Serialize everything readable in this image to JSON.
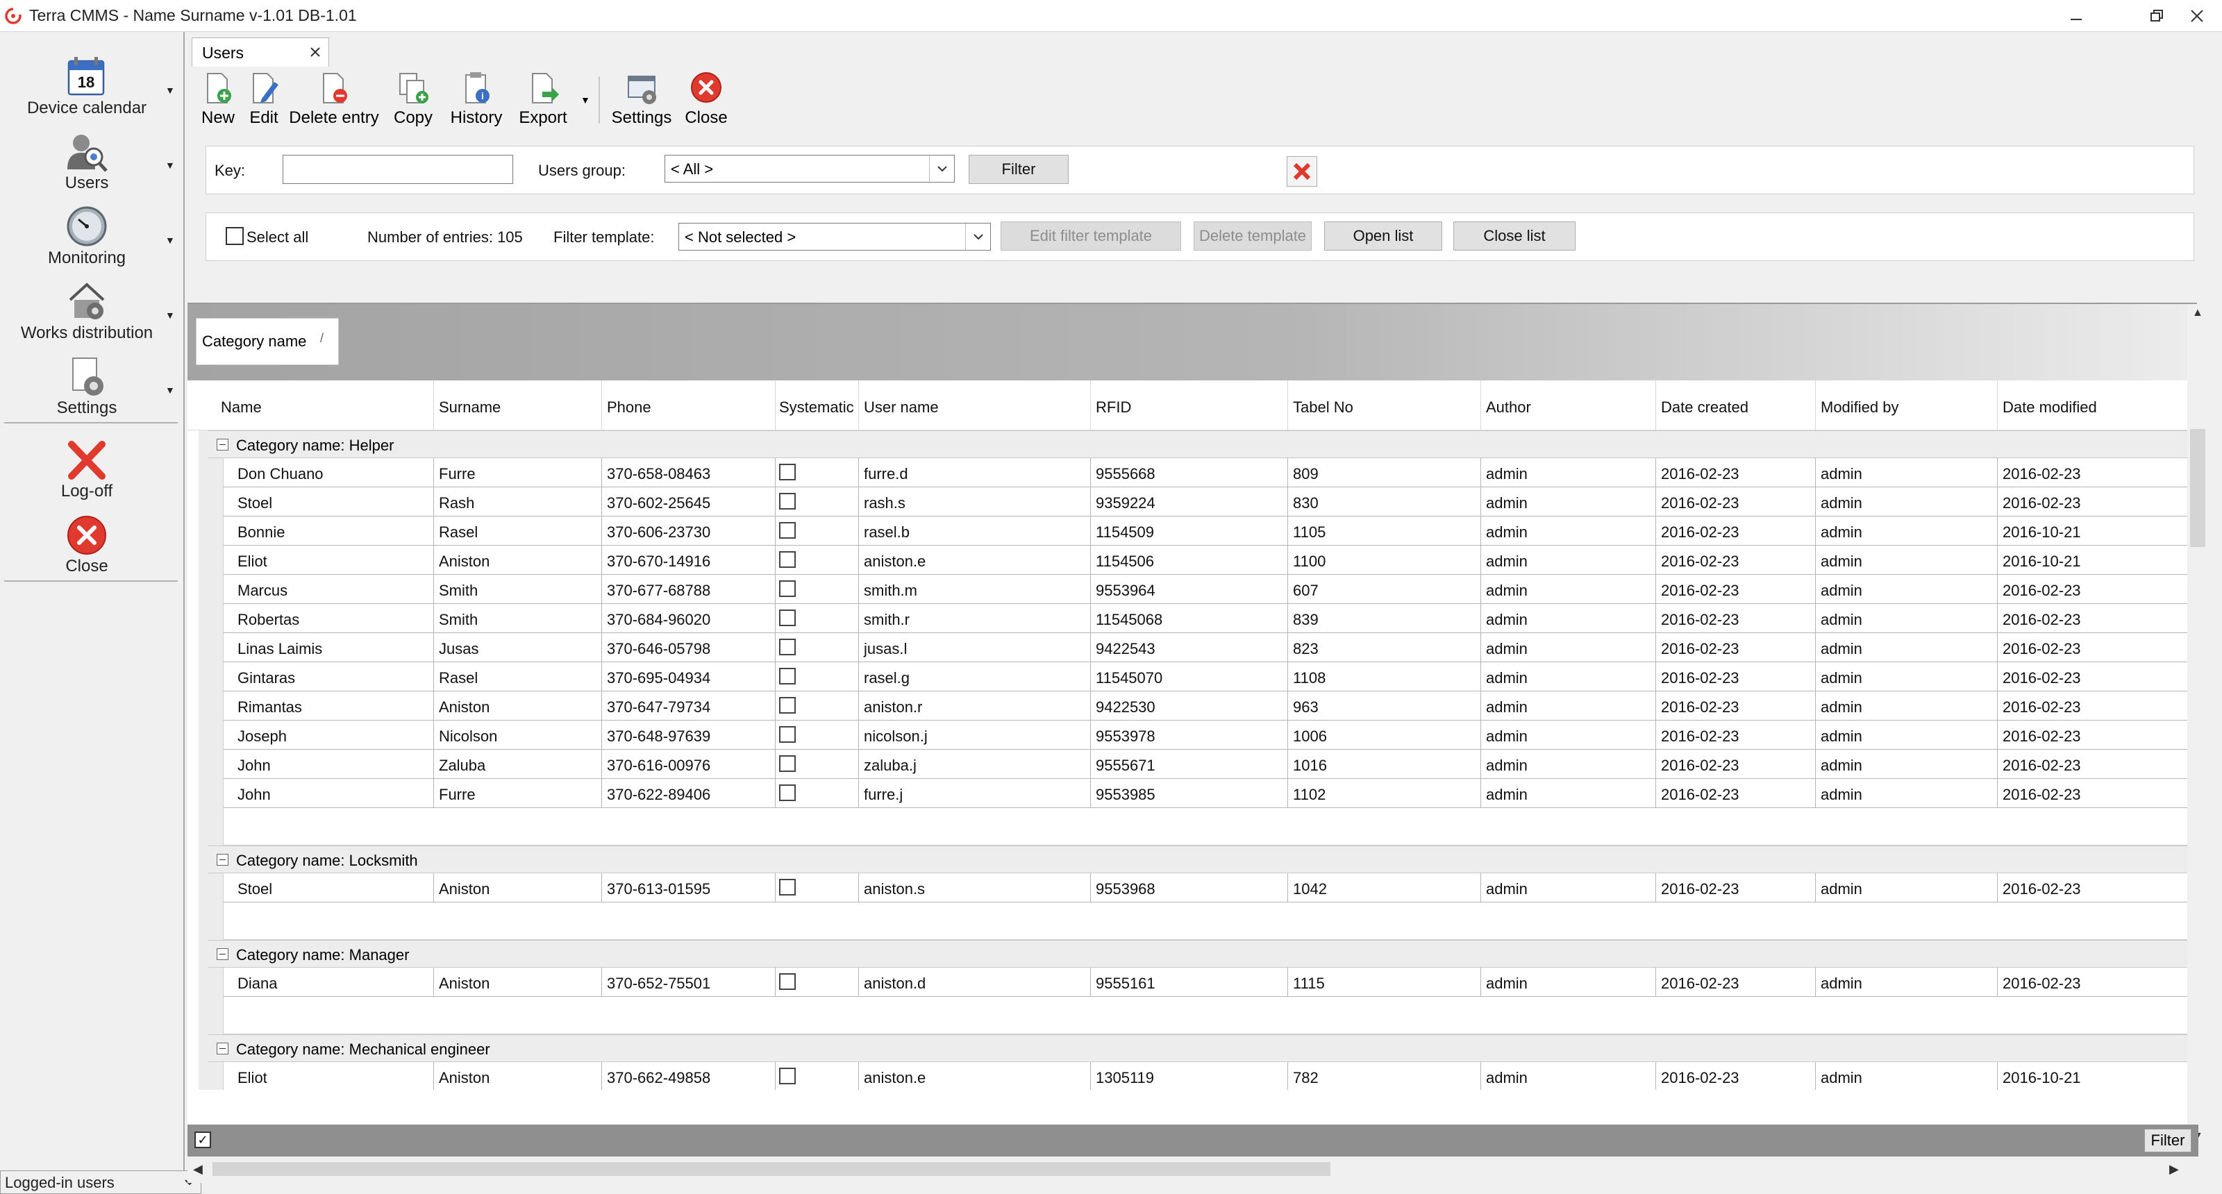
{
  "window": {
    "title": "Terra CMMS - Name Surname  v-1.01 DB-1.01"
  },
  "nav": {
    "items": [
      {
        "label": "Device calendar",
        "icon": "calendar-icon"
      },
      {
        "label": "Users",
        "icon": "users-icon"
      },
      {
        "label": "Monitoring",
        "icon": "monitoring-icon"
      },
      {
        "label": "Works distribution",
        "icon": "works-distribution-icon"
      },
      {
        "label": "Settings",
        "icon": "settings-icon"
      },
      {
        "label": "Log-off",
        "icon": "log-off-icon"
      },
      {
        "label": "Close",
        "icon": "close-icon"
      }
    ],
    "calendar_day": "18",
    "footer_label": "Logged-in users"
  },
  "tab": {
    "label": "Users"
  },
  "toolbar": {
    "new": "New",
    "edit": "Edit",
    "delete": "Delete entry",
    "copy": "Copy",
    "history": "History",
    "export": "Export",
    "settings": "Settings",
    "close": "Close"
  },
  "filter": {
    "key_label": "Key:",
    "key_value": "",
    "group_label": "Users group:",
    "group_value": "< All >",
    "filter_button": "Filter",
    "select_all": "Select all",
    "entries": "Number of entries: 105",
    "template_label": "Filter template:",
    "template_value": "< Not selected >",
    "edit_template": "Edit filter template",
    "delete_template": "Delete template",
    "open_list": "Open list",
    "close_list": "Close list"
  },
  "grid": {
    "group_by": "Category name",
    "sort_mark": "/",
    "columns": [
      "Name",
      "Surname",
      "Phone",
      "Systematic",
      "User name",
      "RFID",
      "Tabel No",
      "Author",
      "Date created",
      "Modified by",
      "Date modified"
    ],
    "groups": [
      {
        "title": "Category name: Helper",
        "rows": [
          [
            "Don Chuano",
            "Furre",
            "370-658-08463",
            "",
            "furre.d",
            "9555668",
            "809",
            "admin",
            "2016-02-23",
            "admin",
            "2016-02-23"
          ],
          [
            "Stoel",
            "Rash",
            "370-602-25645",
            "",
            "rash.s",
            "9359224",
            "830",
            "admin",
            "2016-02-23",
            "admin",
            "2016-02-23"
          ],
          [
            "Bonnie",
            "Rasel",
            "370-606-23730",
            "",
            "rasel.b",
            "1154509",
            "1105",
            "admin",
            "2016-02-23",
            "admin",
            "2016-10-21"
          ],
          [
            "Eliot",
            "Aniston",
            "370-670-14916",
            "",
            "aniston.e",
            "1154506",
            "1100",
            "admin",
            "2016-02-23",
            "admin",
            "2016-10-21"
          ],
          [
            "Marcus",
            "Smith",
            "370-677-68788",
            "",
            "smith.m",
            "9553964",
            "607",
            "admin",
            "2016-02-23",
            "admin",
            "2016-02-23"
          ],
          [
            "Robertas",
            "Smith",
            "370-684-96020",
            "",
            "smith.r",
            "11545068",
            "839",
            "admin",
            "2016-02-23",
            "admin",
            "2016-02-23"
          ],
          [
            "Linas Laimis",
            "Jusas",
            "370-646-05798",
            "",
            "jusas.l",
            "9422543",
            "823",
            "admin",
            "2016-02-23",
            "admin",
            "2016-02-23"
          ],
          [
            "Gintaras",
            "Rasel",
            "370-695-04934",
            "",
            "rasel.g",
            "11545070",
            "1108",
            "admin",
            "2016-02-23",
            "admin",
            "2016-02-23"
          ],
          [
            "Rimantas",
            "Aniston",
            "370-647-79734",
            "",
            "aniston.r",
            "9422530",
            "963",
            "admin",
            "2016-02-23",
            "admin",
            "2016-02-23"
          ],
          [
            "Joseph",
            "Nicolson",
            "370-648-97639",
            "",
            "nicolson.j",
            "9553978",
            "1006",
            "admin",
            "2016-02-23",
            "admin",
            "2016-02-23"
          ],
          [
            "John",
            "Zaluba",
            "370-616-00976",
            "",
            "zaluba.j",
            "9555671",
            "1016",
            "admin",
            "2016-02-23",
            "admin",
            "2016-02-23"
          ],
          [
            "John",
            "Furre",
            "370-622-89406",
            "",
            "furre.j",
            "9553985",
            "1102",
            "admin",
            "2016-02-23",
            "admin",
            "2016-02-23"
          ]
        ]
      },
      {
        "title": "Category name: Locksmith",
        "rows": [
          [
            "Stoel",
            "Aniston",
            "370-613-01595",
            "",
            "aniston.s",
            "9553968",
            "1042",
            "admin",
            "2016-02-23",
            "admin",
            "2016-02-23"
          ]
        ]
      },
      {
        "title": "Category name: Manager",
        "rows": [
          [
            "Diana",
            "Aniston",
            "370-652-75501",
            "",
            "aniston.d",
            "9555161",
            "1115",
            "admin",
            "2016-02-23",
            "admin",
            "2016-02-23"
          ]
        ]
      },
      {
        "title": "Category name: Mechanical engineer",
        "rows": [
          [
            "Eliot",
            "Aniston",
            "370-662-49858",
            "",
            "aniston.e",
            "1305119",
            "782",
            "admin",
            "2016-02-23",
            "admin",
            "2016-10-21"
          ]
        ]
      }
    ]
  },
  "footer": {
    "filter_button": "Filter"
  },
  "colors": {
    "accent_red": "#e03a2f",
    "group_band": "#a3a3a3",
    "filter_bar": "#8f8f8f"
  }
}
